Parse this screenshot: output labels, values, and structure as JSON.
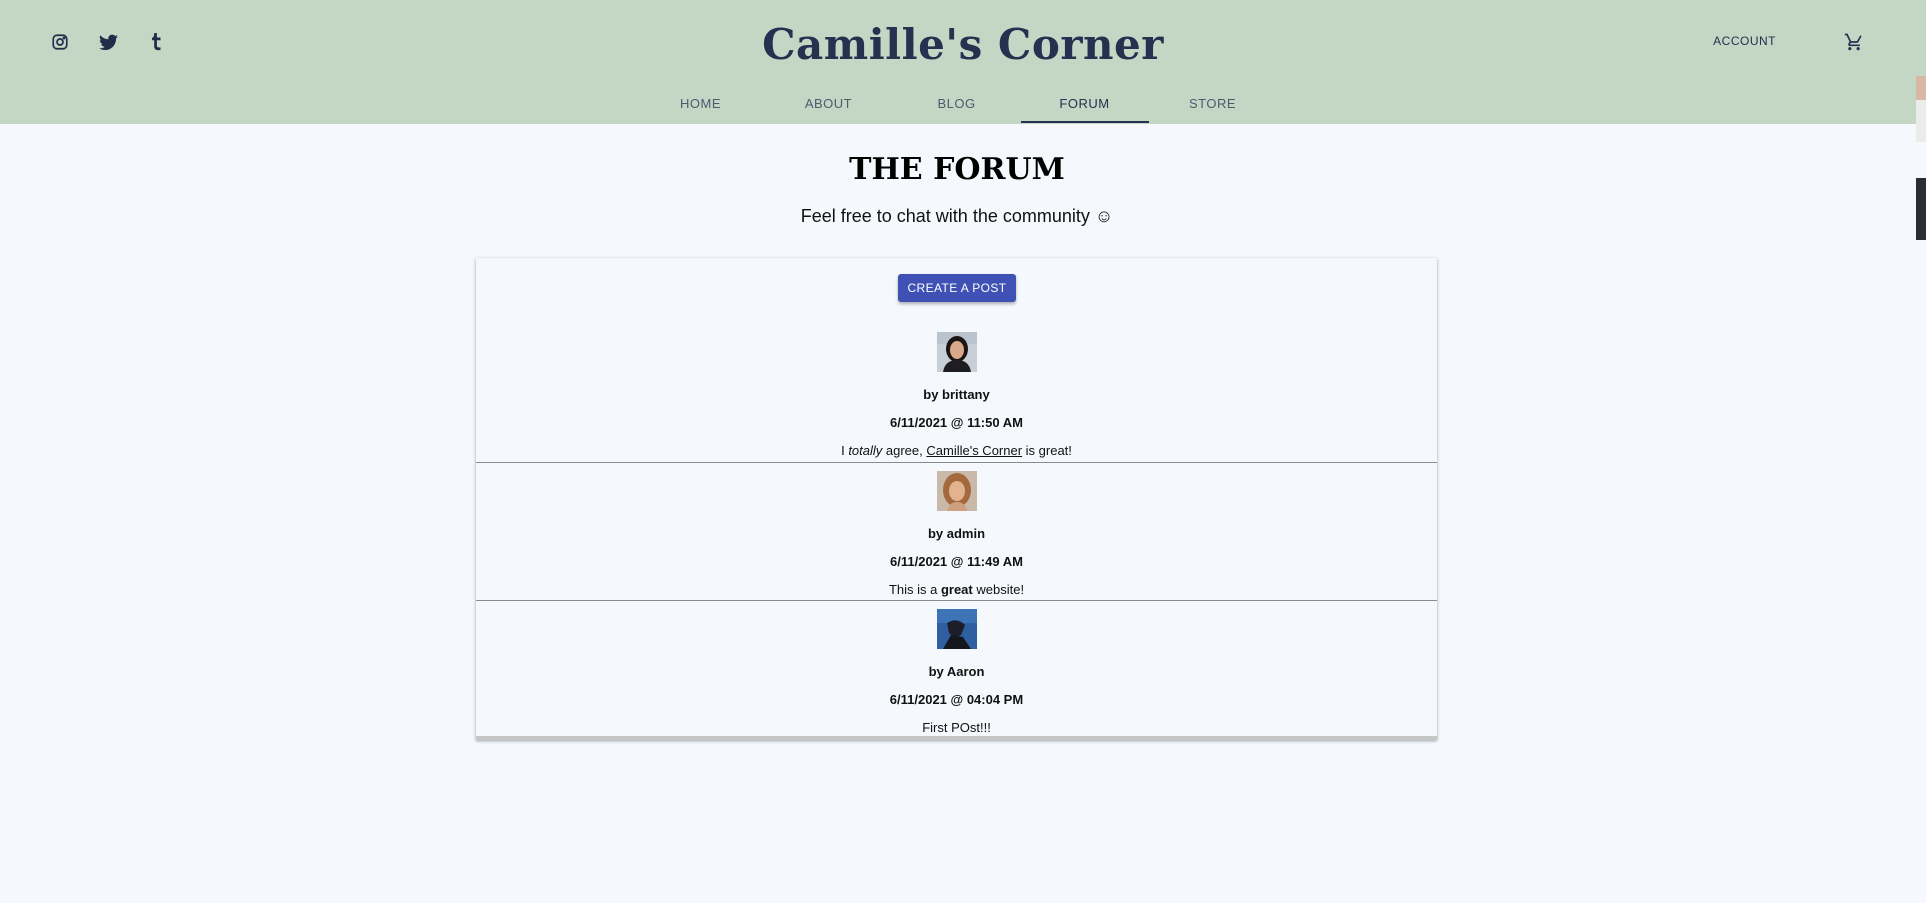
{
  "header": {
    "brand": "Camille's Corner",
    "account_label": "ACCOUNT",
    "social": [
      "instagram-icon",
      "twitter-icon",
      "tumblr-icon"
    ],
    "colors": {
      "header_bg": "#c4d6c4",
      "brand": "#24314f"
    }
  },
  "nav": {
    "items": [
      {
        "label": "HOME"
      },
      {
        "label": "ABOUT"
      },
      {
        "label": "BLOG"
      },
      {
        "label": "FORUM"
      },
      {
        "label": "STORE"
      }
    ],
    "active": "FORUM"
  },
  "main": {
    "title": "THE FORUM",
    "subtitle": "Feel free to chat with the community ☺",
    "create_button": "CREATE A POST"
  },
  "posts": [
    {
      "author": "by brittany",
      "date": "6/11/2021 @ 11:50 AM",
      "body_pre": "I ",
      "body_em": "totally",
      "body_mid": " agree, ",
      "body_link": "Camille's Corner",
      "body_post": " is great!"
    },
    {
      "author": "by admin",
      "date": "6/11/2021 @ 11:49 AM",
      "body_pre": "This is a ",
      "body_strong": "great",
      "body_post": " website!"
    },
    {
      "author": "by Aaron",
      "date": "6/11/2021 @ 04:04 PM",
      "body": "First POst!!!"
    }
  ],
  "colors": {
    "accent_button": "#3f51b5",
    "page_bg": "#f5f8fc"
  }
}
